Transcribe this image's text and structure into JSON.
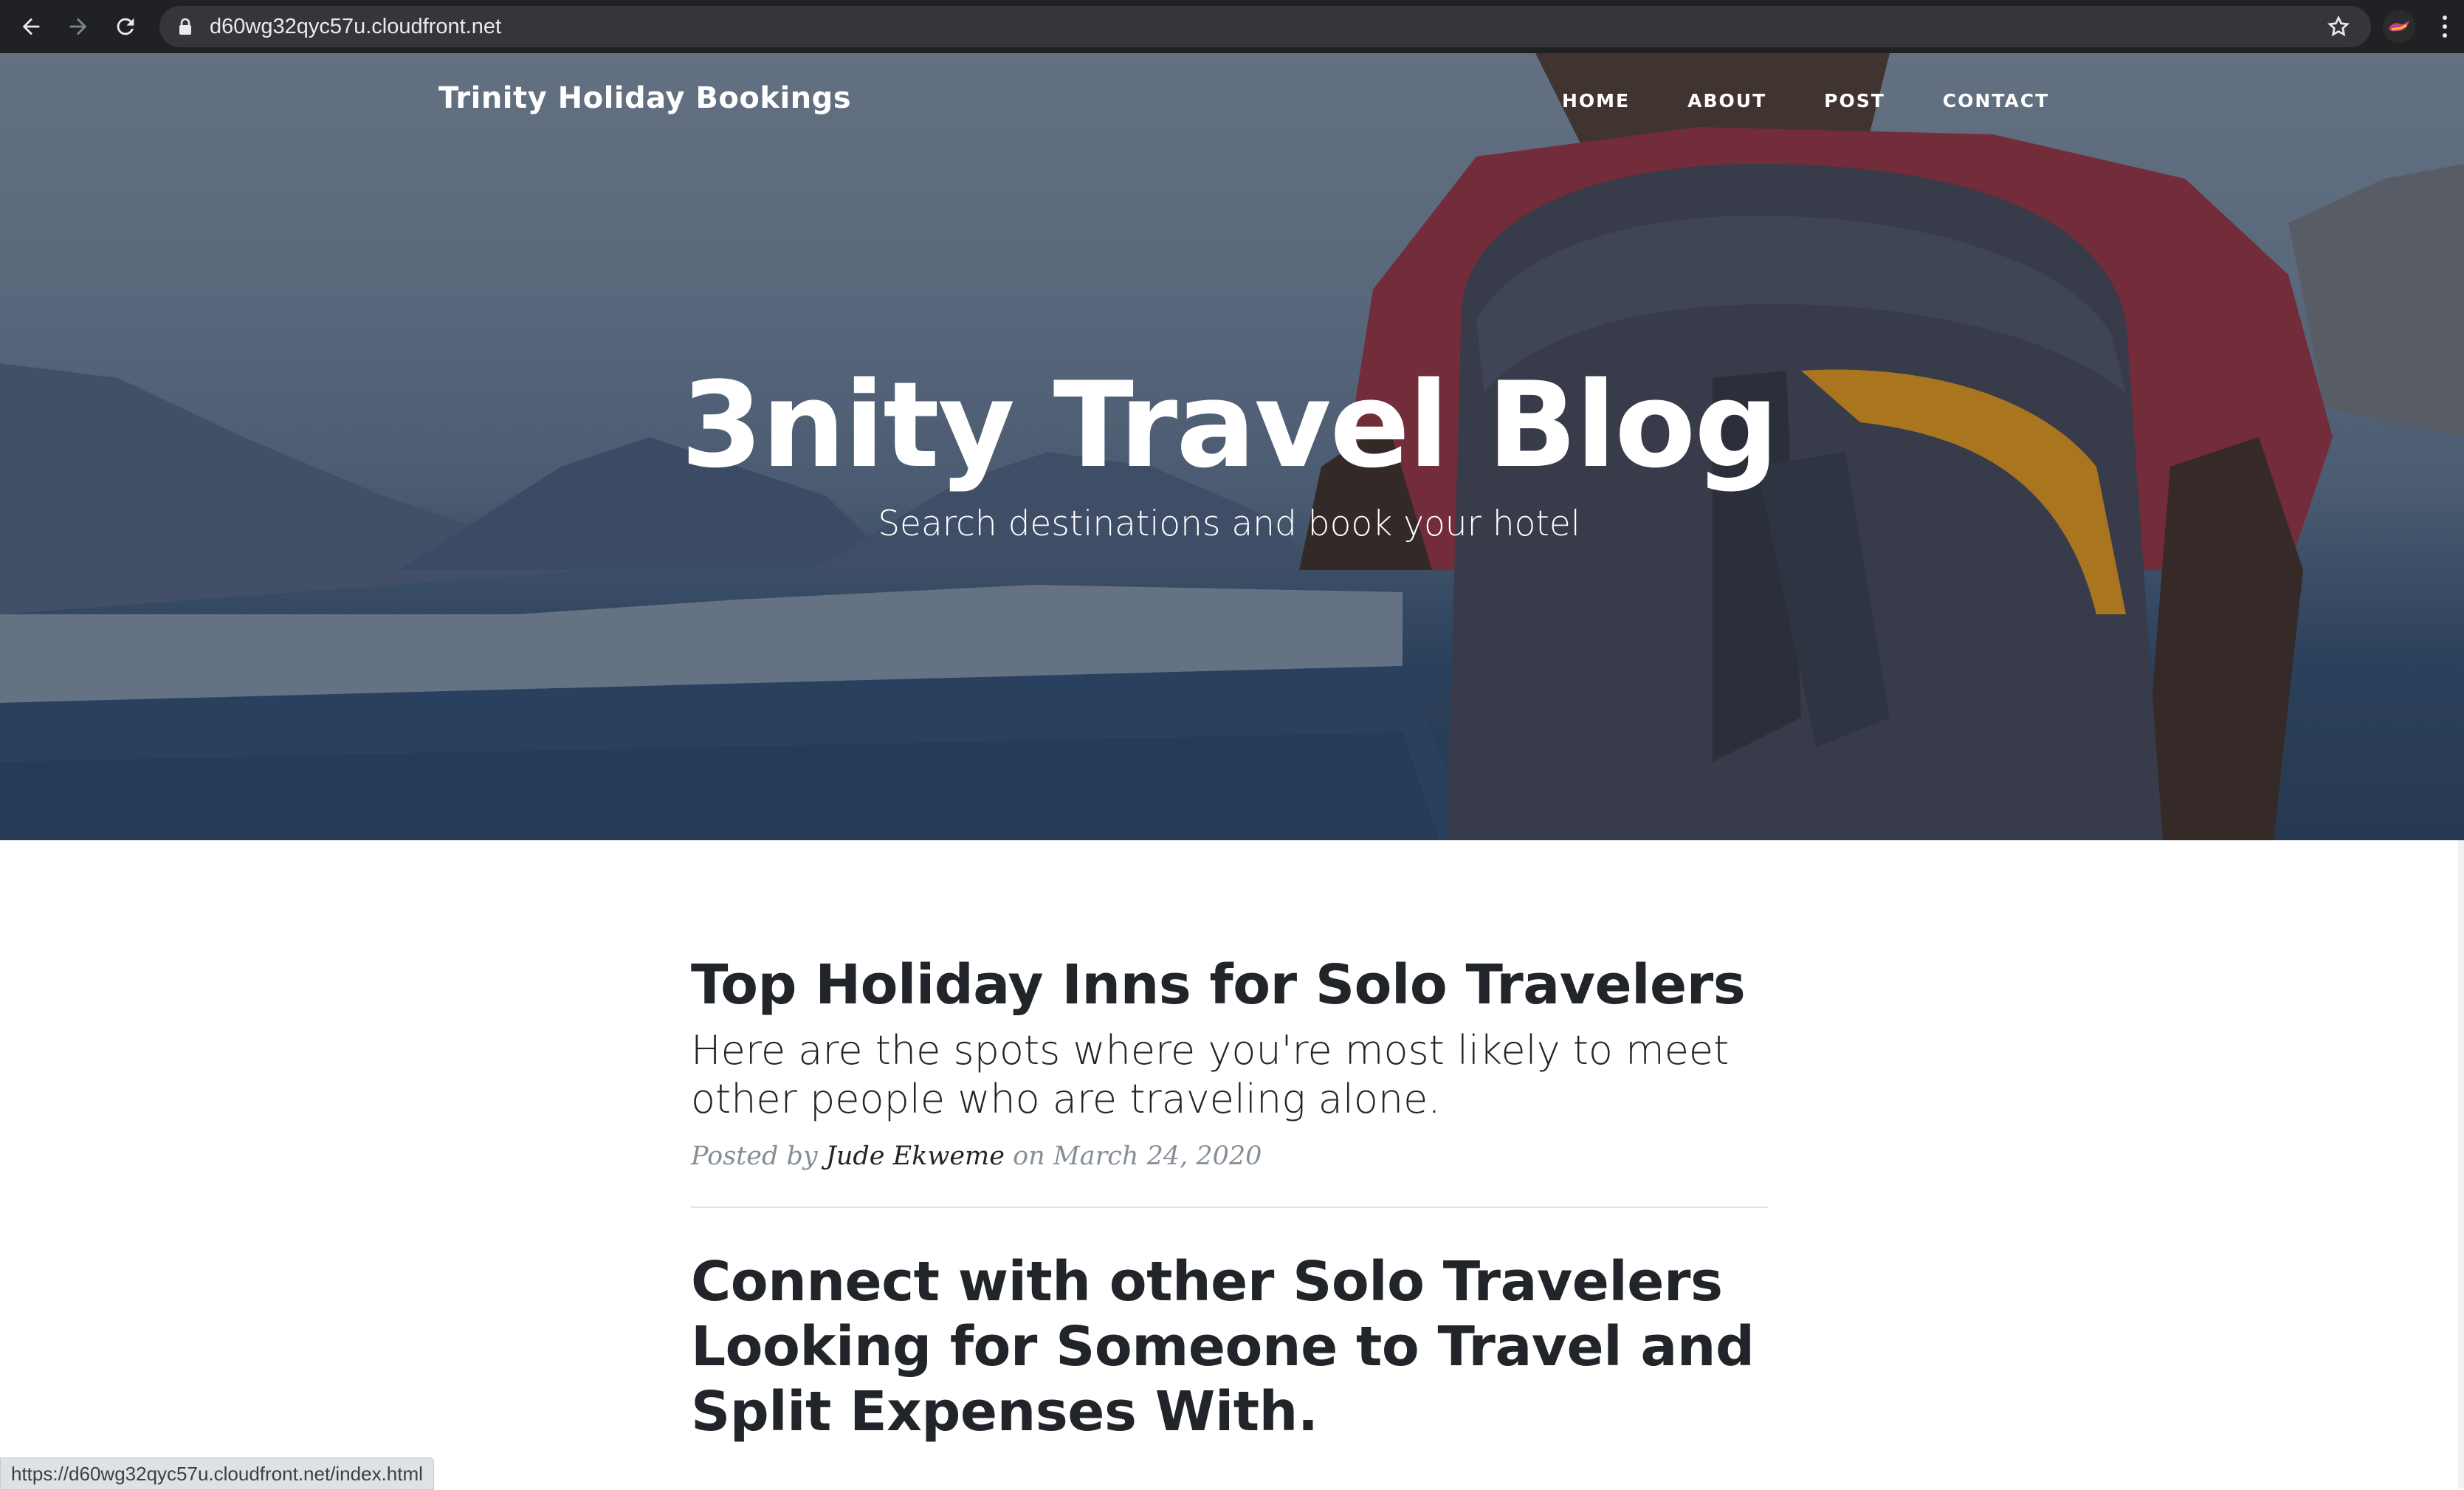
{
  "browser": {
    "url": "d60wg32qyc57u.cloudfront.net",
    "status_url": "https://d60wg32qyc57u.cloudfront.net/index.html",
    "icons": [
      "back-arrow-icon",
      "forward-arrow-icon",
      "reload-icon",
      "lock-icon",
      "star-icon",
      "profile-avatar",
      "kebab-menu-icon"
    ]
  },
  "site": {
    "brand": "Trinity Holiday Bookings",
    "nav": [
      "HOME",
      "ABOUT",
      "POST",
      "CONTACT"
    ]
  },
  "hero": {
    "title": "3nity Travel Blog",
    "subtitle": "Search destinations and book your hotel"
  },
  "posts": [
    {
      "title": "Top Holiday Inns for Solo Travelers",
      "subtitle": "Here are the spots where you're most likely to meet other people who are traveling alone.",
      "meta_prefix": "Posted by",
      "author": "Jude Ekweme",
      "meta_on": "on",
      "date": "March 24, 2020"
    },
    {
      "title": "Connect with other Solo Travelers Looking for Someone to Travel and Split Expenses With."
    }
  ],
  "colors": {
    "chrome": "#202124",
    "text_dark": "#212529",
    "meta_grey": "#868e96"
  }
}
